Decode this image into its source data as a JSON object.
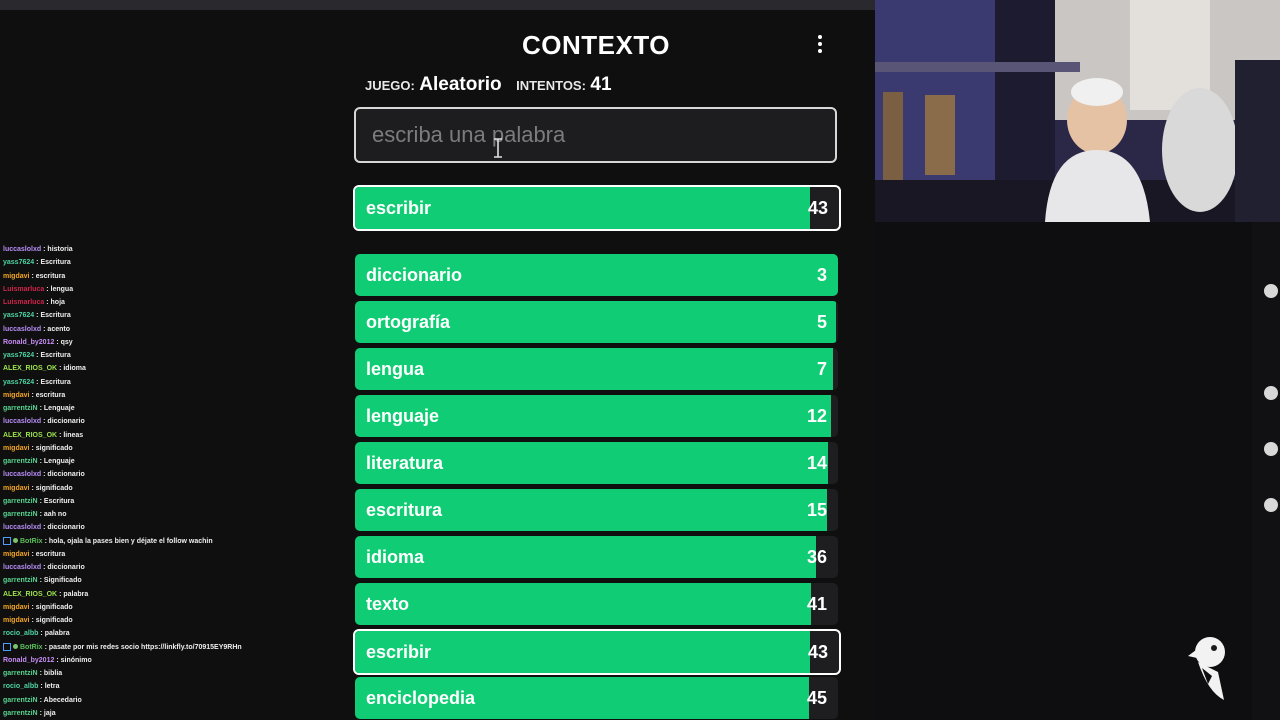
{
  "header": {
    "title": "CONTEXTO"
  },
  "game": {
    "mode_label": "JUEGO:",
    "mode_value": "Aleatorio",
    "tries_label": "INTENTOS:",
    "tries_value": "41"
  },
  "search": {
    "placeholder": "escriba una palabra"
  },
  "latest_guess": {
    "word": "escribir",
    "rank": "43",
    "fill": 0.94
  },
  "guesses": [
    {
      "word": "diccionario",
      "rank": "3",
      "fill": 1.0,
      "highlighted": false
    },
    {
      "word": "ortografía",
      "rank": "5",
      "fill": 0.995,
      "highlighted": false
    },
    {
      "word": "lengua",
      "rank": "7",
      "fill": 0.99,
      "highlighted": false
    },
    {
      "word": "lenguaje",
      "rank": "12",
      "fill": 0.985,
      "highlighted": false
    },
    {
      "word": "literatura",
      "rank": "14",
      "fill": 0.98,
      "highlighted": false
    },
    {
      "word": "escritura",
      "rank": "15",
      "fill": 0.978,
      "highlighted": false
    },
    {
      "word": "idioma",
      "rank": "36",
      "fill": 0.955,
      "highlighted": false
    },
    {
      "word": "texto",
      "rank": "41",
      "fill": 0.945,
      "highlighted": false
    },
    {
      "word": "escribir",
      "rank": "43",
      "fill": 0.94,
      "highlighted": true
    },
    {
      "word": "enciclopedia",
      "rank": "45",
      "fill": 0.94,
      "highlighted": false
    }
  ],
  "chat": [
    {
      "user": "luccaslolxd",
      "color": "#b88ef7",
      "text": "historia"
    },
    {
      "user": "yass7624",
      "color": "#4fd3a0",
      "text": "Escritura"
    },
    {
      "user": "migdavi",
      "color": "#f5a623",
      "text": "escritura"
    },
    {
      "user": "Luismarluca",
      "color": "#d0234a",
      "text": "lengua"
    },
    {
      "user": "Luismarluca",
      "color": "#d0234a",
      "text": "hoja"
    },
    {
      "user": "yass7624",
      "color": "#4fd3a0",
      "text": "Escritura"
    },
    {
      "user": "luccaslolxd",
      "color": "#b88ef7",
      "text": "acento"
    },
    {
      "user": "Ronald_by2012",
      "color": "#c78df5",
      "text": "qsy"
    },
    {
      "user": "yass7624",
      "color": "#4fd3a0",
      "text": "Escritura"
    },
    {
      "user": "ALEX_RIOS_OK",
      "color": "#9de34d",
      "text": "idioma"
    },
    {
      "user": "yass7624",
      "color": "#4fd3a0",
      "text": "Escritura"
    },
    {
      "user": "migdavi",
      "color": "#f5a623",
      "text": "escritura"
    },
    {
      "user": "garrentziN",
      "color": "#56d48f",
      "text": "Lenguaje"
    },
    {
      "user": "luccaslolxd",
      "color": "#b88ef7",
      "text": "diccionario"
    },
    {
      "user": "ALEX_RIOS_OK",
      "color": "#9de34d",
      "text": "lineas"
    },
    {
      "user": "migdavi",
      "color": "#f5a623",
      "text": "significado"
    },
    {
      "user": "garrentziN",
      "color": "#56d48f",
      "text": "Lenguaje"
    },
    {
      "user": "luccaslolxd",
      "color": "#b88ef7",
      "text": "diccionario"
    },
    {
      "user": "migdavi",
      "color": "#f5a623",
      "text": "significado"
    },
    {
      "user": "garrentziN",
      "color": "#56d48f",
      "text": "Escritura"
    },
    {
      "user": "garrentziN",
      "color": "#56d48f",
      "text": "aah no"
    },
    {
      "user": "luccaslolxd",
      "color": "#b88ef7",
      "text": "diccionario"
    },
    {
      "user": "BotRix",
      "color": "#5ac05a",
      "text": "hola, ojala la pases bien y déjate el follow wachin",
      "bot": true
    },
    {
      "user": "migdavi",
      "color": "#f5a623",
      "text": "escritura"
    },
    {
      "user": "luccaslolxd",
      "color": "#b88ef7",
      "text": "diccionario"
    },
    {
      "user": "garrentziN",
      "color": "#56d48f",
      "text": "Significado"
    },
    {
      "user": "ALEX_RIOS_OK",
      "color": "#9de34d",
      "text": "palabra"
    },
    {
      "user": "migdavi",
      "color": "#f5a623",
      "text": "significado"
    },
    {
      "user": "migdavi",
      "color": "#f5a623",
      "text": "significado"
    },
    {
      "user": "rocio_albb",
      "color": "#4fd3a0",
      "text": "palabra"
    },
    {
      "user": "BotRix",
      "color": "#5ac05a",
      "text": "pasate por mis redes socio https://linkfly.to/70915EY9RHn",
      "bot": true
    },
    {
      "user": "Ronald_by2012",
      "color": "#c78df5",
      "text": "sinónimo"
    },
    {
      "user": "garrentziN",
      "color": "#56d48f",
      "text": "biblia"
    },
    {
      "user": "rocio_albb",
      "color": "#4fd3a0",
      "text": "letra"
    },
    {
      "user": "garrentziN",
      "color": "#56d48f",
      "text": "Abecedario"
    },
    {
      "user": "garrentziN",
      "color": "#56d48f",
      "text": "jaja"
    }
  ],
  "colors": {
    "accent_green": "#10cc74",
    "background": "#0f0f10",
    "bar_track": "#1e1e20"
  }
}
